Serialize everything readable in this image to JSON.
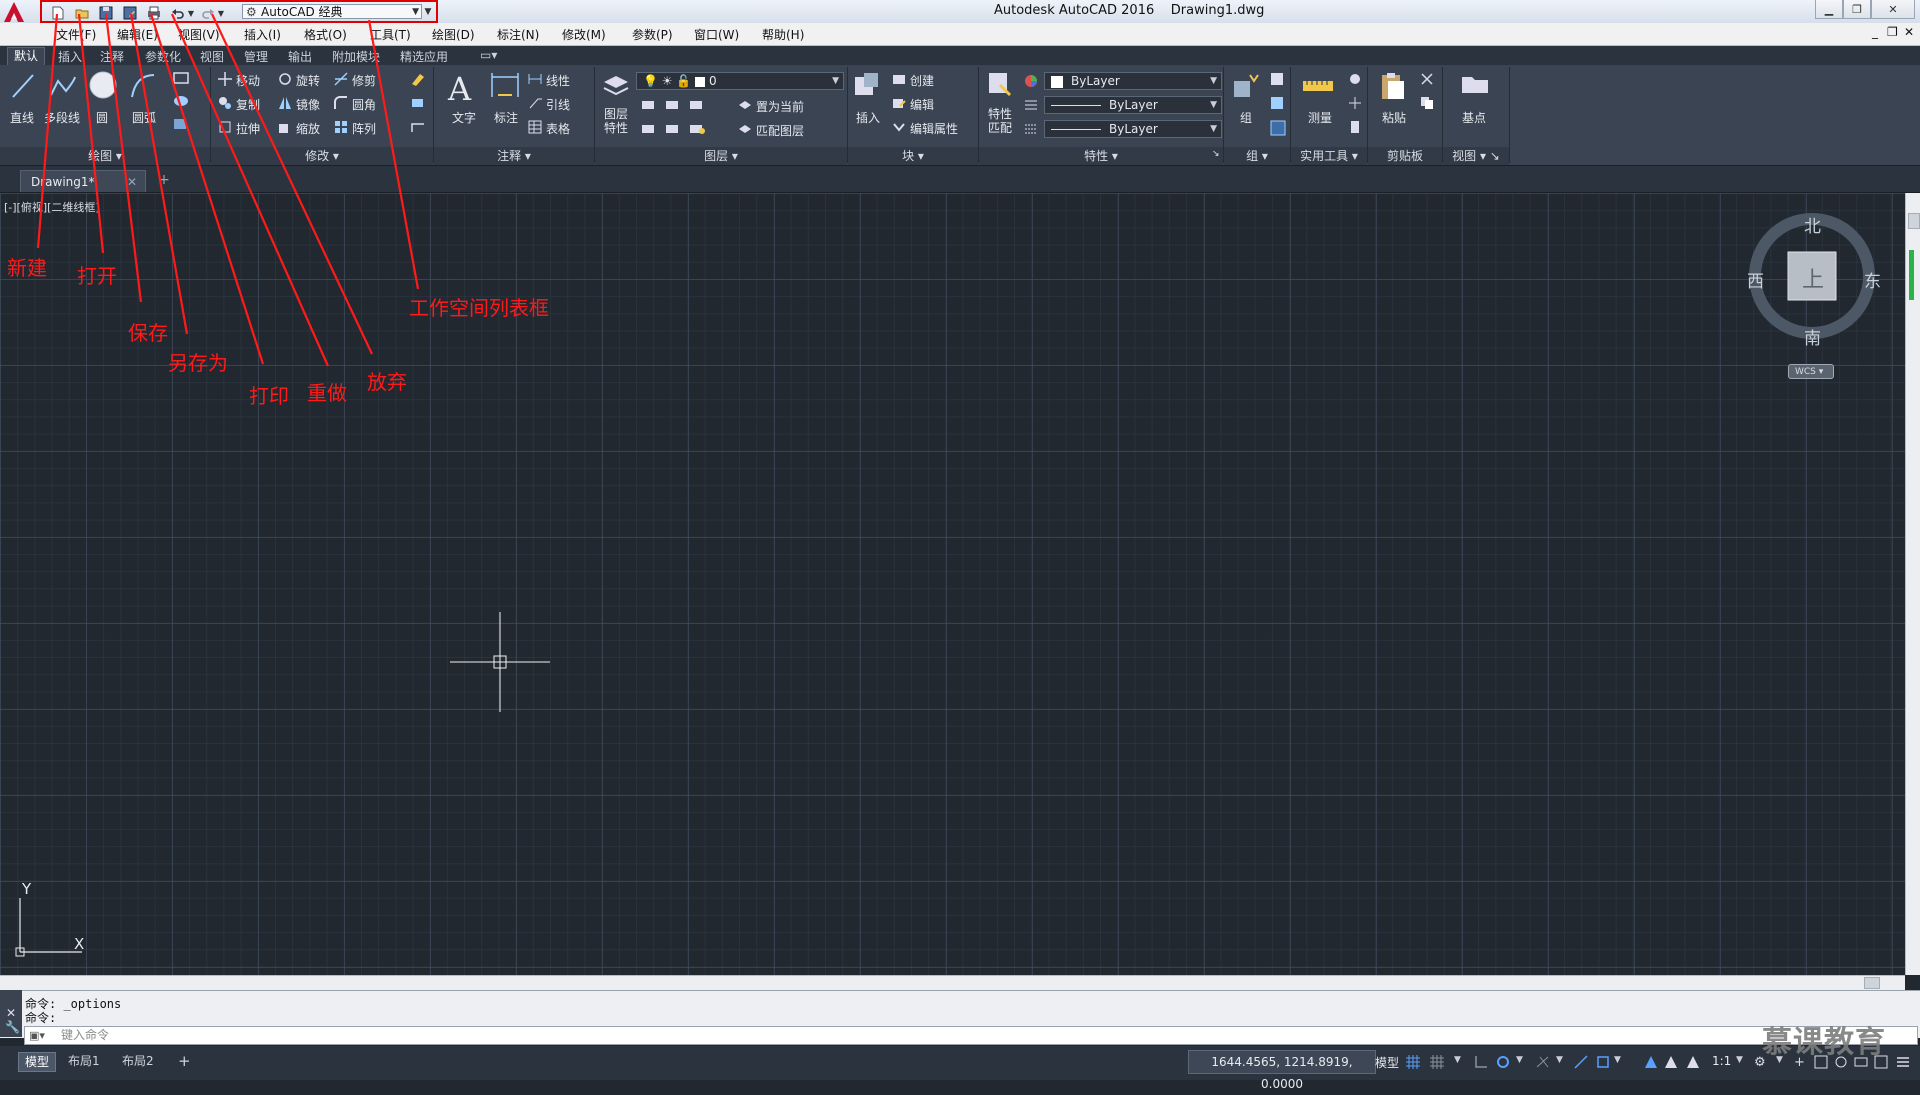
{
  "titlebar": {
    "app_title": "Autodesk AutoCAD 2016",
    "document": "Drawing1.dwg",
    "workspace": "AutoCAD 经典"
  },
  "menu": [
    "文件(F)",
    "编辑(E)",
    "视图(V)",
    "插入(I)",
    "格式(O)",
    "工具(T)",
    "绘图(D)",
    "标注(N)",
    "修改(M)",
    "参数(P)",
    "窗口(W)",
    "帮助(H)"
  ],
  "ribbon_tabs": [
    "默认",
    "插入",
    "注释",
    "参数化",
    "视图",
    "管理",
    "输出",
    "附加模块",
    "精选应用"
  ],
  "ribbon": {
    "draw": {
      "line": "直线",
      "polyline": "多段线",
      "circle": "圆",
      "arc": "圆弧",
      "title": "绘图"
    },
    "modify": {
      "move": "移动",
      "rotate": "旋转",
      "trim": "修剪",
      "copy": "复制",
      "mirror": "镜像",
      "fillet": "圆角",
      "stretch": "拉伸",
      "scale": "缩放",
      "array": "阵列",
      "title": "修改"
    },
    "annotation": {
      "text": "文字",
      "dimension": "标注",
      "linear": "线性",
      "leader": "引线",
      "table": "表格",
      "title": "注释"
    },
    "layers": {
      "properties": "图层\n特性",
      "current_layer": "0",
      "set_current": "置为当前",
      "match_layer": "匹配图层",
      "title": "图层"
    },
    "block": {
      "insert": "插入",
      "create": "创建",
      "edit": "编辑",
      "edit_attributes": "编辑属性",
      "title": "块"
    },
    "properties": {
      "match": "特性\n匹配",
      "color": "ByLayer",
      "linetype": "ByLayer",
      "lineweight": "ByLayer",
      "title": "特性"
    },
    "groups": {
      "group": "组",
      "title": "组"
    },
    "utilities": {
      "measure": "测量",
      "title": "实用工具"
    },
    "clipboard": {
      "paste": "粘贴",
      "title": "剪贴板"
    },
    "view": {
      "base": "基点",
      "title": "视图"
    }
  },
  "doc_tab": "Drawing1*",
  "viewport_label": "[-][俯视][二维线框]",
  "annotations": [
    "新建",
    "打开",
    "保存",
    "另存为",
    "打印",
    "重做",
    "放弃",
    "工作空间列表框"
  ],
  "viewcube": {
    "north": "北",
    "south": "南",
    "east": "东",
    "west": "西",
    "face": "上",
    "wcs": "WCS"
  },
  "ucs": {
    "x": "X",
    "y": "Y"
  },
  "command": {
    "history": [
      "命令: _options",
      "命令:"
    ],
    "placeholder": "键入命令"
  },
  "status": {
    "layout_tabs": [
      "模型",
      "布局1",
      "布局2"
    ],
    "coordinates": "1644.4565, 1214.8919, 0.0000",
    "model": "模型",
    "scale": "1:1"
  },
  "watermark": "慕课教育",
  "colors": {
    "annotation": "#ff1a1a",
    "canvas": "#212830",
    "ribbon": "#3b4453"
  }
}
